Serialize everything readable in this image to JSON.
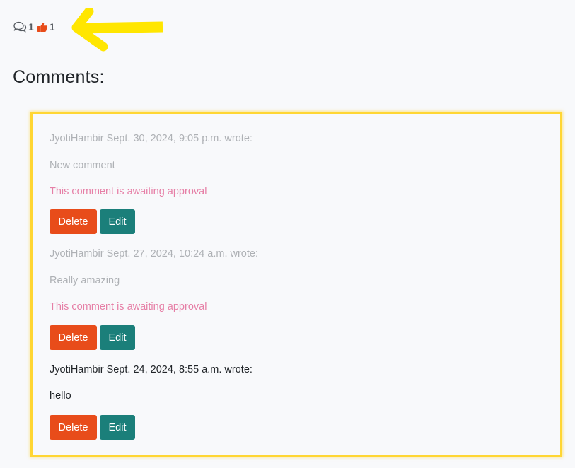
{
  "post_stats": {
    "comment_icon": "comments-icon",
    "comment_count": "1",
    "like_icon": "thumbs-up-icon",
    "like_count": "1"
  },
  "colors": {
    "delete": "#e84c1a",
    "edit": "#1b7f7a",
    "highlight": "#ffd633",
    "annotation": "#ffe600",
    "like_icon": "#e84c1a",
    "pending_status": "#e67fa6"
  },
  "heading": "Comments:",
  "comments": [
    {
      "meta": "JyotiHambir Sept. 30, 2024, 9:05 p.m. wrote:",
      "body": "New comment",
      "status": "This comment is awaiting approval",
      "delete_label": "Delete",
      "edit_label": "Edit"
    },
    {
      "meta": "JyotiHambir Sept. 27, 2024, 10:24 a.m. wrote:",
      "body": "Really amazing",
      "status": "This comment is awaiting approval",
      "delete_label": "Delete",
      "edit_label": "Edit"
    },
    {
      "meta": "JyotiHambir Sept. 24, 2024, 8:55 a.m. wrote:",
      "body": "hello",
      "delete_label": "Delete",
      "edit_label": "Edit"
    }
  ]
}
